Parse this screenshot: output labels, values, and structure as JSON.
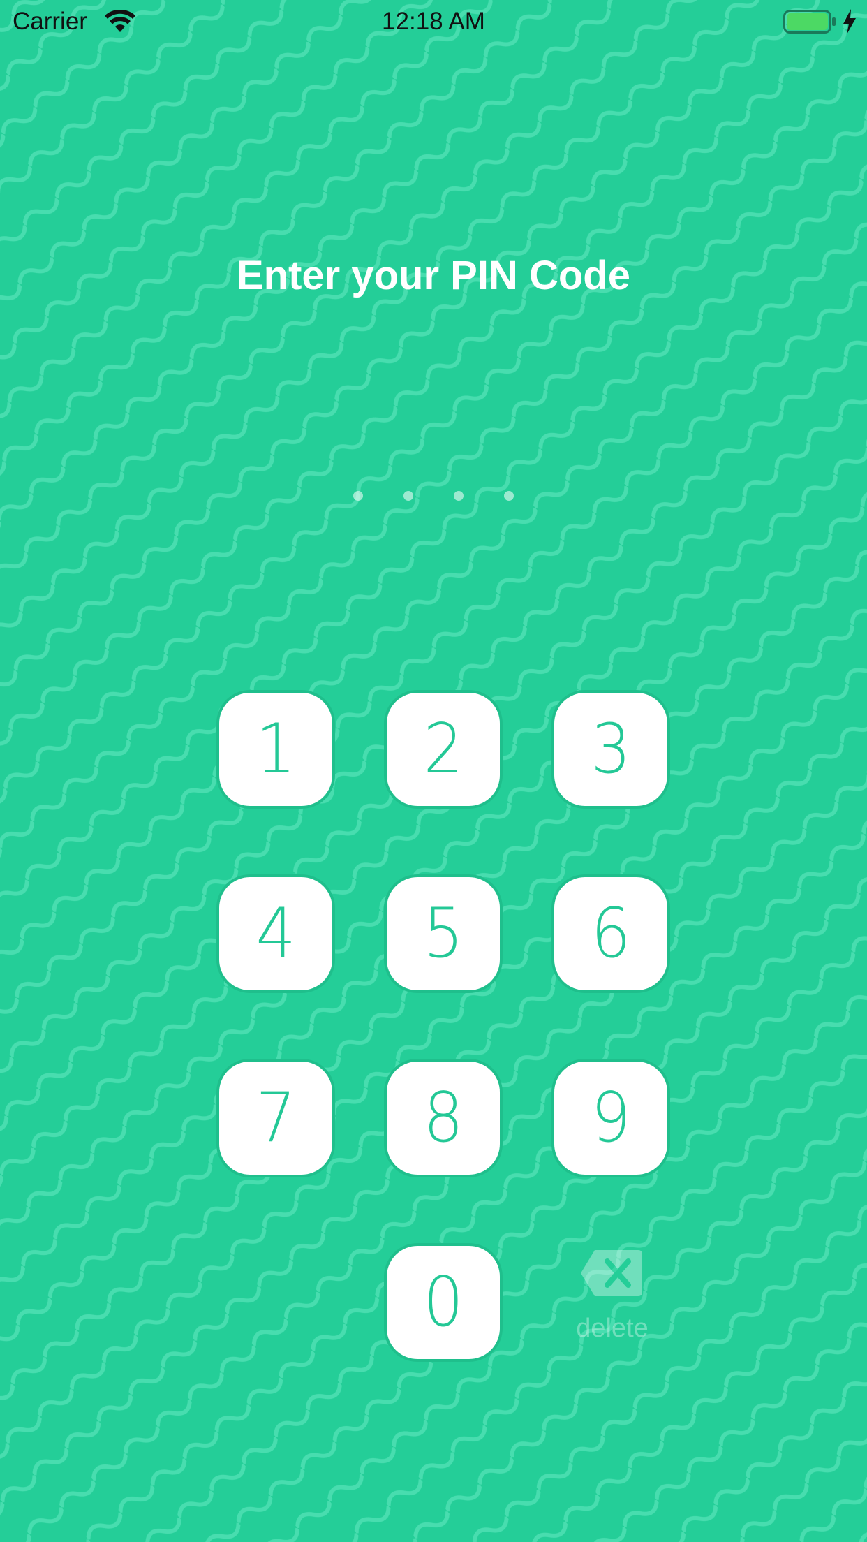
{
  "status_bar": {
    "carrier": "Carrier",
    "time": "12:18 AM",
    "wifi_icon": "wifi-icon",
    "battery_icon": "battery-icon",
    "charging_icon": "charging-bolt-icon"
  },
  "title": "Enter your PIN Code",
  "pin": {
    "length": 4,
    "entered": 0
  },
  "keypad": {
    "keys": [
      "1",
      "2",
      "3",
      "4",
      "5",
      "6",
      "7",
      "8",
      "9",
      "0"
    ],
    "delete_label": "delete",
    "delete_icon": "backspace-icon"
  },
  "colors": {
    "background": "#24ce98",
    "wave_lines": "#4fe0b3",
    "key_background": "#ffffff",
    "key_text": "#24c896",
    "title_text": "#ffffff"
  }
}
